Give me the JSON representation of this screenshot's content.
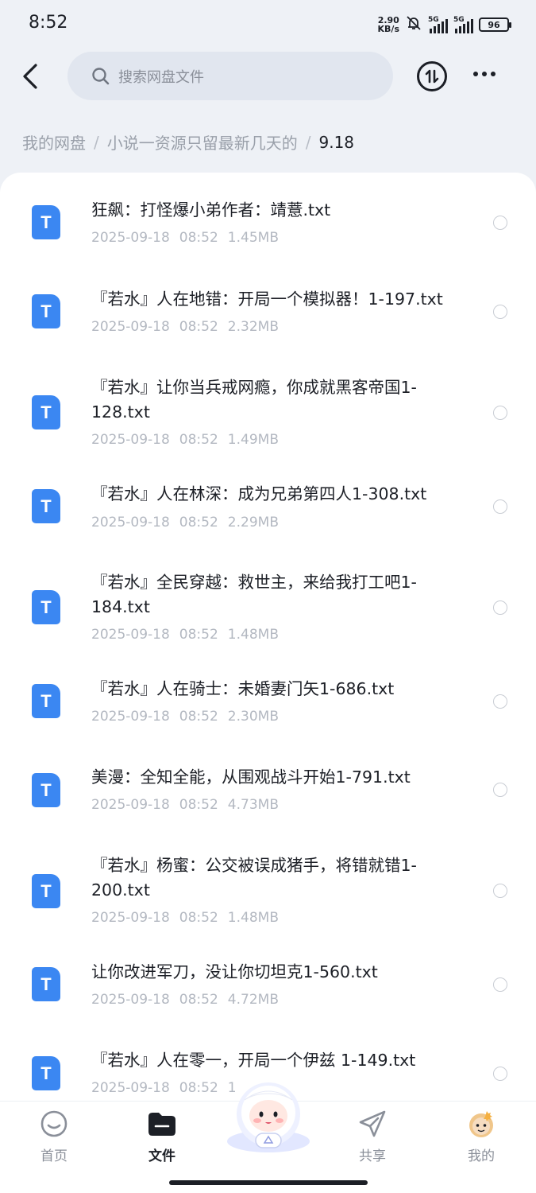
{
  "status_bar": {
    "time": "8:52",
    "net_speed_value": "2.90",
    "net_speed_unit": "KB/s",
    "signal1": "5G",
    "signal2": "5G",
    "battery": "96"
  },
  "top_nav": {
    "search_placeholder": "搜索网盘文件"
  },
  "breadcrumb": {
    "items": [
      "我的网盘",
      "小说一资源只留最新几天的",
      "9.18"
    ],
    "separator": "/"
  },
  "files": [
    {
      "name": "狂飙：打怪爆小弟作者：靖薏.txt",
      "date": "2025-09-18",
      "time": "08:52",
      "size": "1.45MB",
      "icon": "T"
    },
    {
      "name": "『若水』人在地错：开局一个模拟器！1-197.txt",
      "date": "2025-09-18",
      "time": "08:52",
      "size": "2.32MB",
      "icon": "T"
    },
    {
      "name": "『若水』让你当兵戒网瘾，你成就黑客帝国1-128.txt",
      "date": "2025-09-18",
      "time": "08:52",
      "size": "1.49MB",
      "icon": "T"
    },
    {
      "name": "『若水』人在林深：成为兄弟第四人1-308.txt",
      "date": "2025-09-18",
      "time": "08:52",
      "size": "2.29MB",
      "icon": "T"
    },
    {
      "name": "『若水』全民穿越：救世主，来给我打工吧1-184.txt",
      "date": "2025-09-18",
      "time": "08:52",
      "size": "1.48MB",
      "icon": "T"
    },
    {
      "name": "『若水』人在骑士：未婚妻门矢1-686.txt",
      "date": "2025-09-18",
      "time": "08:52",
      "size": "2.30MB",
      "icon": "T"
    },
    {
      "name": "美漫：全知全能，从围观战斗开始1-791.txt",
      "date": "2025-09-18",
      "time": "08:52",
      "size": "4.73MB",
      "icon": "T"
    },
    {
      "name": "『若水』杨蜜：公交被误成猪手，将错就错1-200.txt",
      "date": "2025-09-18",
      "time": "08:52",
      "size": "1.48MB",
      "icon": "T"
    },
    {
      "name": "让你改进军刀，没让你切坦克1-560.txt",
      "date": "2025-09-18",
      "time": "08:52",
      "size": "4.72MB",
      "icon": "T"
    },
    {
      "name": "『若水』人在零一，开局一个伊兹 1-149.txt",
      "date": "2025-09-18",
      "time": "08:52",
      "size": "1",
      "icon": "T"
    }
  ],
  "bottom_nav": {
    "tabs": [
      {
        "label": "首页",
        "icon": "home-icon"
      },
      {
        "label": "文件",
        "icon": "folder-icon"
      },
      {
        "label": "共享",
        "icon": "send-icon"
      },
      {
        "label": "我的",
        "icon": "avatar-icon"
      }
    ]
  },
  "colors": {
    "accent": "#3b87f2",
    "background": "#eef1f6",
    "panel": "#ffffff"
  }
}
